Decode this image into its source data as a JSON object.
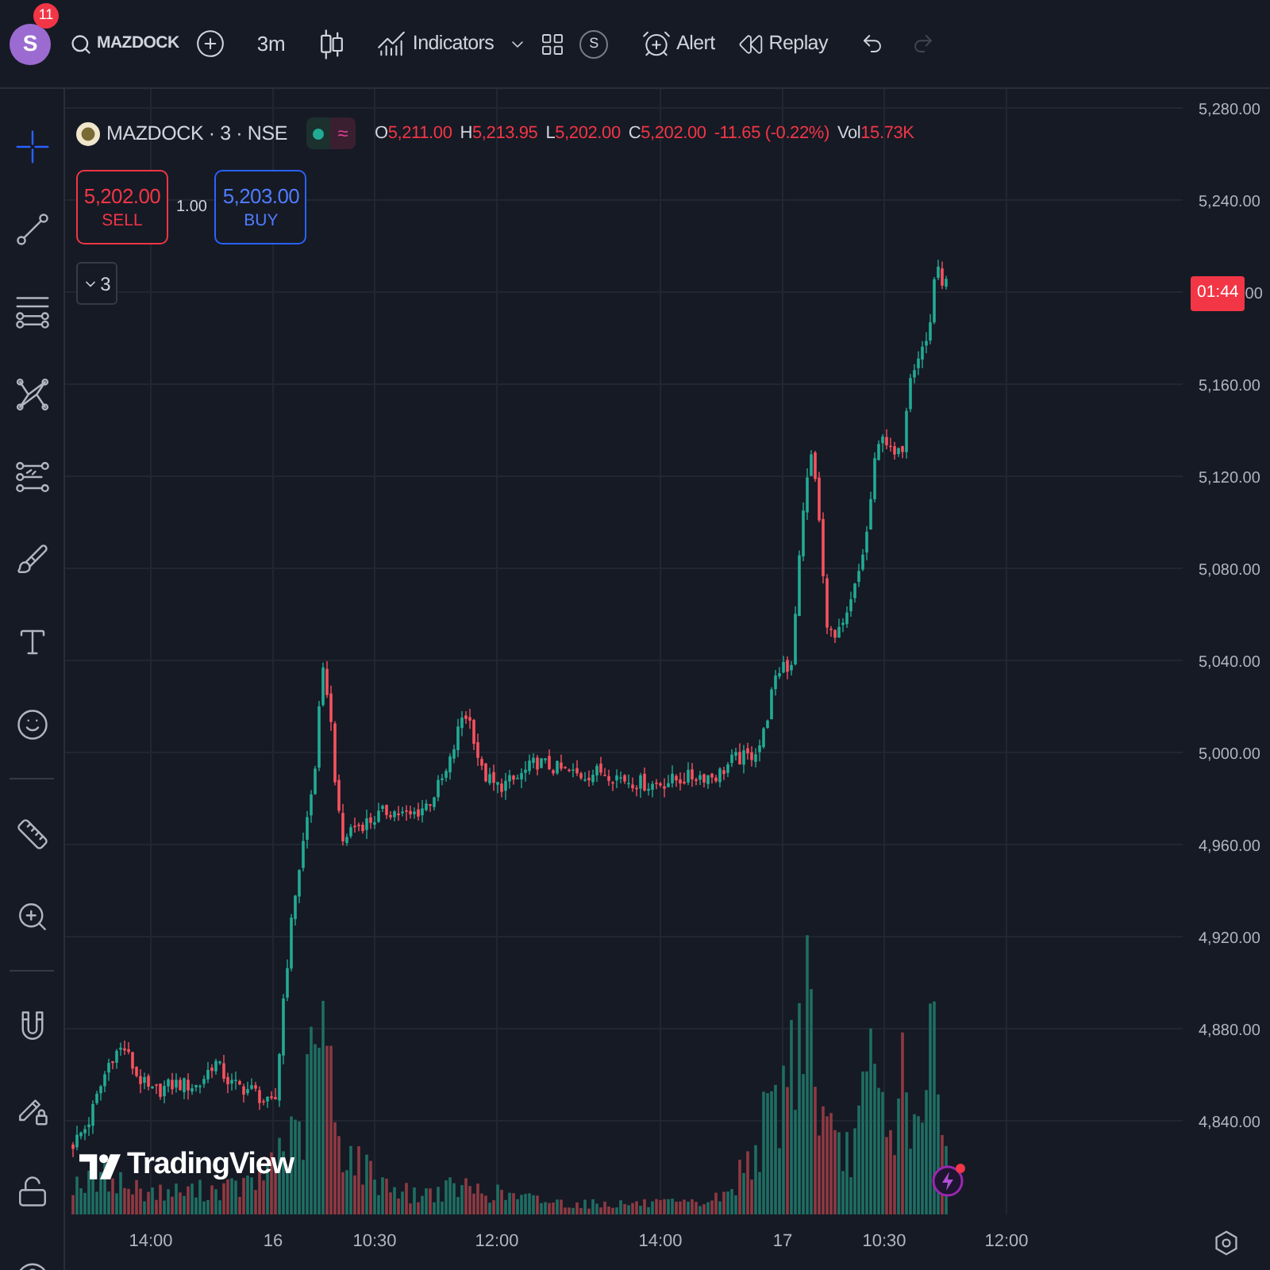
{
  "toolbar": {
    "avatar": {
      "letter": "S",
      "badge": "11"
    },
    "symbol": "MAZDOCK",
    "interval": "3m",
    "indicators_label": "Indicators",
    "profile_letter": "S",
    "alert_label": "Alert",
    "replay_label": "Replay",
    "redo": {
      "disabled": true
    }
  },
  "tool_groups": [
    {
      "tools": [
        {
          "kind": "crosshair",
          "selected": true
        },
        {
          "kind": "trend-line",
          "selected": false
        },
        {
          "kind": "fib-lines",
          "selected": false
        },
        {
          "kind": "pattern",
          "selected": false
        },
        {
          "kind": "projection",
          "selected": false
        },
        {
          "kind": "brush",
          "selected": false
        },
        {
          "kind": "text",
          "selected": false
        },
        {
          "kind": "emoji",
          "selected": false
        }
      ]
    },
    {
      "tools": [
        {
          "kind": "ruler",
          "selected": false
        },
        {
          "kind": "zoom",
          "selected": false
        }
      ]
    },
    {
      "tools": [
        {
          "kind": "magnet",
          "selected": false
        },
        {
          "kind": "drawing-lock",
          "selected": false
        },
        {
          "kind": "lock",
          "selected": false
        },
        {
          "kind": "eye",
          "selected": false
        }
      ]
    }
  ],
  "legend": {
    "symbol": "MAZDOCK · 3 · NSE",
    "market_open": true,
    "data_flag": "≈",
    "falling": true,
    "ohlc": [
      {
        "label": "O",
        "value": "5,211.00"
      },
      {
        "label": "H",
        "value": "5,213.95"
      },
      {
        "label": "L",
        "value": "5,202.00"
      },
      {
        "label": "C",
        "value": "5,202.00"
      }
    ],
    "change": "-11.65 (-0.22%)",
    "volume": {
      "label": "Vol",
      "value": "15.73K"
    }
  },
  "trade": {
    "sell": {
      "price": "5,202.00",
      "label": "SELL"
    },
    "quantity": "1.00",
    "buy": {
      "price": "5,203.00",
      "label": "BUY"
    }
  },
  "indicators": {
    "expanded": false,
    "count": "3"
  },
  "chart": {
    "logo": "TradingView",
    "lightning": {
      "notification": true
    }
  },
  "price_axis": [
    {
      "kind": "tick",
      "text": "5,280.00"
    },
    {
      "kind": "tick",
      "text": "5,240.00"
    },
    {
      "kind": "countdown",
      "countdown": "01:44",
      "text": "00"
    },
    {
      "kind": "tick",
      "text": "5,160.00"
    },
    {
      "kind": "tick",
      "text": "5,120.00"
    },
    {
      "kind": "tick",
      "text": "5,080.00"
    },
    {
      "kind": "tick",
      "text": "5,040.00"
    },
    {
      "kind": "tick",
      "text": "5,000.00"
    },
    {
      "kind": "tick",
      "text": "4,960.00"
    },
    {
      "kind": "tick",
      "text": "4,920.00"
    },
    {
      "kind": "tick",
      "text": "4,880.00"
    },
    {
      "kind": "tick",
      "text": "4,840.00"
    }
  ],
  "time_axis": [
    "14:00",
    "16",
    "10:30",
    "12:00",
    "14:00",
    "17",
    "10:30",
    "12:00"
  ]
}
